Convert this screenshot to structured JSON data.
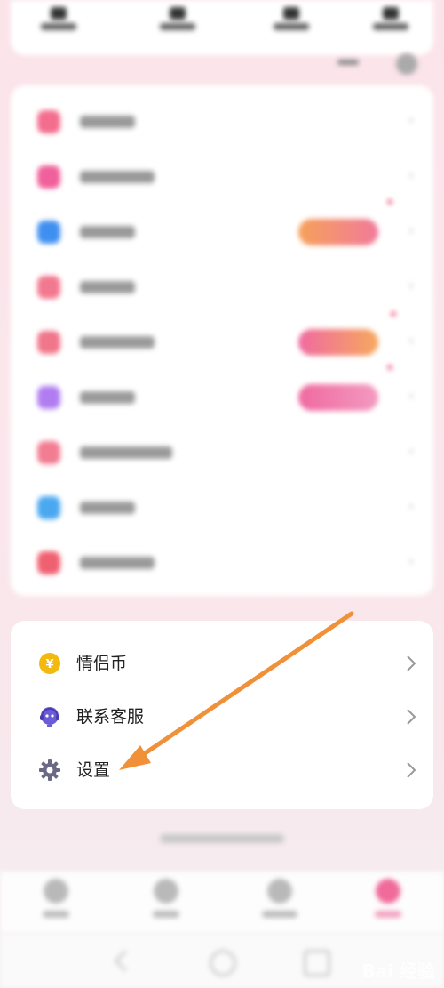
{
  "menu": {
    "items": [
      {
        "label": "情侣币",
        "icon": "yen-coin-icon"
      },
      {
        "label": "联系客服",
        "icon": "customer-service-icon"
      },
      {
        "label": "设置",
        "icon": "gear-icon"
      }
    ]
  },
  "colors": {
    "coin": "#f2b90e",
    "service": "#6b5bd6",
    "gear": "#6a6a86",
    "annotation_arrow": "#f0913a",
    "tab_active": "#f06a9a"
  },
  "watermark": {
    "text": "Bai 经验"
  }
}
